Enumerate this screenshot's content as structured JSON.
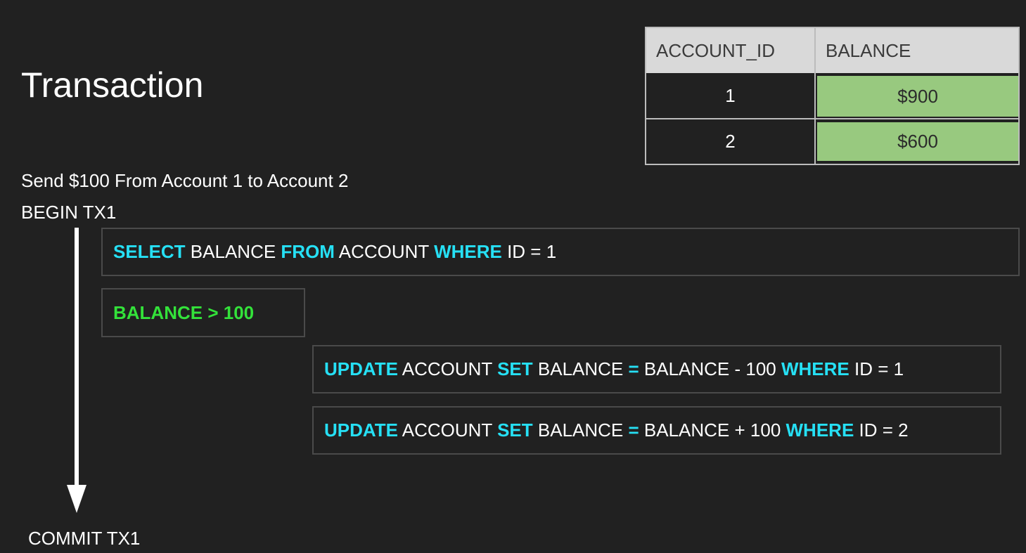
{
  "title": "Transaction",
  "description": "Send $100 From Account 1 to Account 2",
  "begin": "BEGIN TX1",
  "commit": "COMMIT TX1",
  "statements": {
    "select": {
      "kw1": "SELECT",
      "t1": " BALANCE ",
      "kw2": "FROM",
      "t2": " ACCOUNT ",
      "kw3": "WHERE",
      "t3": " ID = 1"
    },
    "condition": "BALANCE > 100",
    "update1": {
      "kw1": "UPDATE",
      "t1": " ACCOUNT ",
      "kw2": "SET",
      "t2": " BALANCE ",
      "eq": "=",
      "t3": " BALANCE - 100 ",
      "kw3": "WHERE",
      "t4": " ID = 1"
    },
    "update2": {
      "kw1": "UPDATE",
      "t1": " ACCOUNT ",
      "kw2": "SET",
      "t2": " BALANCE ",
      "eq": "=",
      "t3": " BALANCE + 100 ",
      "kw3": "WHERE",
      "t4": " ID = 2"
    }
  },
  "table": {
    "headers": [
      "ACCOUNT_ID",
      "BALANCE"
    ],
    "rows": [
      {
        "id": "1",
        "balance": "$900"
      },
      {
        "id": "2",
        "balance": "$600"
      }
    ]
  },
  "colors": {
    "background": "#212121",
    "keyword": "#26e0f5",
    "condition": "#33e23a",
    "balance_cell": "#98c97f",
    "header_cell": "#d9d9d9"
  }
}
